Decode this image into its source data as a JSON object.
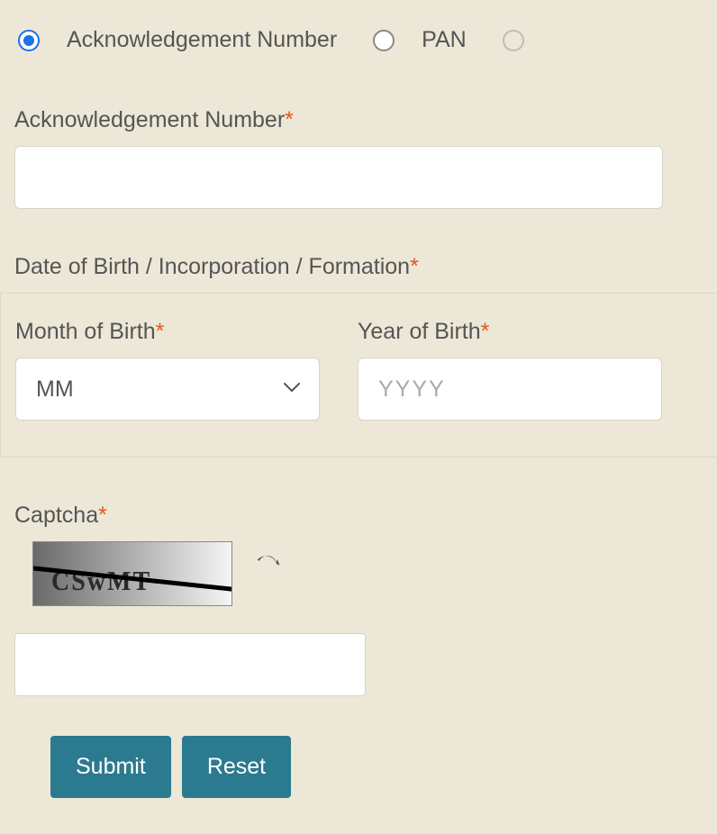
{
  "radios": {
    "ack": {
      "label": "Acknowledgement Number",
      "selected": true
    },
    "pan": {
      "label": "PAN",
      "selected": false
    }
  },
  "fields": {
    "ack_number": {
      "label": "Acknowledgement Number",
      "value": ""
    },
    "dob_section_label": "Date of Birth / Incorporation / Formation",
    "month": {
      "label": "Month of Birth",
      "placeholder": "MM",
      "value": ""
    },
    "year": {
      "label": "Year of Birth",
      "placeholder": "YYYY",
      "value": ""
    },
    "captcha": {
      "label": "Captcha",
      "image_text": "CSwMT",
      "value": ""
    }
  },
  "buttons": {
    "submit": "Submit",
    "reset": "Reset"
  },
  "required_mark": "*"
}
